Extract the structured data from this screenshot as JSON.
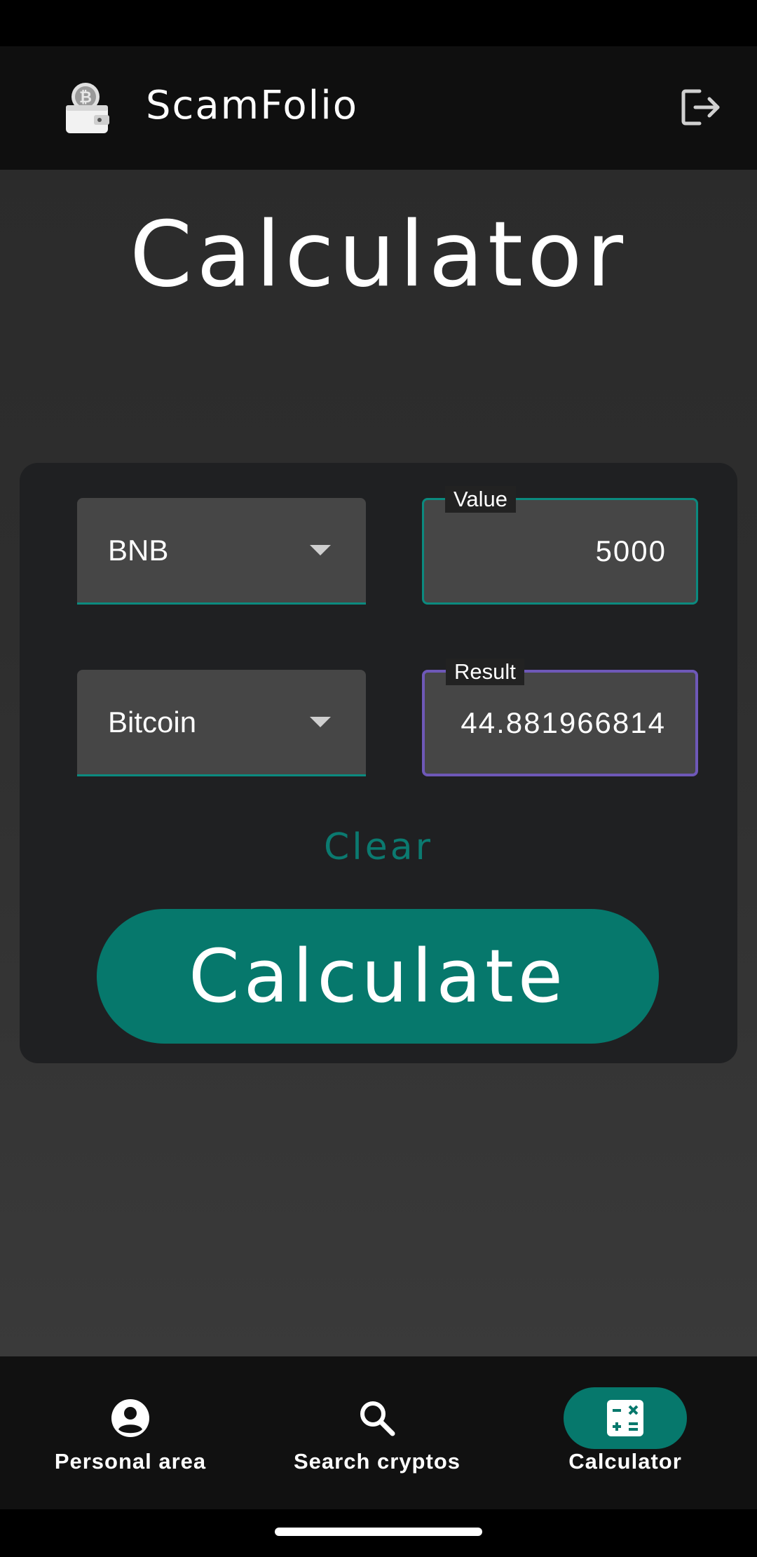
{
  "app_bar": {
    "title": "ScamFolio",
    "logo_icon": "wallet-bitcoin-icon",
    "logout_icon": "logout-icon"
  },
  "page": {
    "title": "Calculator"
  },
  "converter": {
    "from_currency": "BNB",
    "to_currency": "Bitcoin",
    "value_label": "Value",
    "value": "5000",
    "result_label": "Result",
    "result": "44.881966814",
    "clear_label": "Clear",
    "calculate_label": "Calculate"
  },
  "bottom_nav": {
    "items": [
      {
        "label": "Personal area",
        "icon": "account-circle-icon",
        "active": false
      },
      {
        "label": "Search cryptos",
        "icon": "search-icon",
        "active": false
      },
      {
        "label": "Calculator",
        "icon": "calculator-icon",
        "active": true
      }
    ]
  },
  "colors": {
    "accent": "#06786c",
    "result_border": "#6e58b8",
    "card_bg": "#1f2022",
    "field_bg": "#464646"
  }
}
